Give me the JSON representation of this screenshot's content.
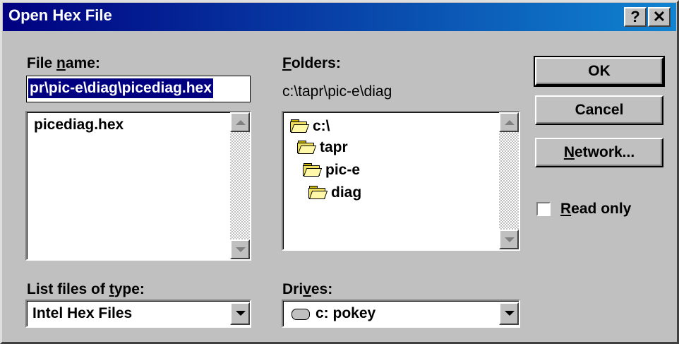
{
  "window": {
    "title": "Open Hex File"
  },
  "titlebar": {
    "help_label": "?",
    "close_label": "✕"
  },
  "file_name": {
    "label_pre": "File ",
    "label_access": "n",
    "label_post": "ame:",
    "value": "pr\\pic-e\\diag\\picediag.hex",
    "files": [
      "picediag.hex"
    ]
  },
  "folders": {
    "label_access": "F",
    "label_post": "olders:",
    "current_path": "c:\\tapr\\pic-e\\diag",
    "items": [
      "c:\\",
      "tapr",
      "pic-e",
      "diag"
    ]
  },
  "buttons": {
    "ok": "OK",
    "cancel": "Cancel",
    "network_access": "N",
    "network_post": "etwork..."
  },
  "read_only": {
    "label_access": "R",
    "label_post": "ead only",
    "checked": false
  },
  "file_type": {
    "label_pre": "List files of ",
    "label_access": "t",
    "label_post": "ype:",
    "value": "Intel Hex Files"
  },
  "drives": {
    "label_pre": "Dri",
    "label_access": "v",
    "label_post": "es:",
    "value": "c: pokey"
  },
  "icons": {
    "folder": "folder-open-icon",
    "drive": "hard-drive-icon"
  },
  "colors": {
    "title_start": "#000080",
    "title_end": "#1084d0",
    "face": "#c0c0c0",
    "selection": "#000080"
  }
}
